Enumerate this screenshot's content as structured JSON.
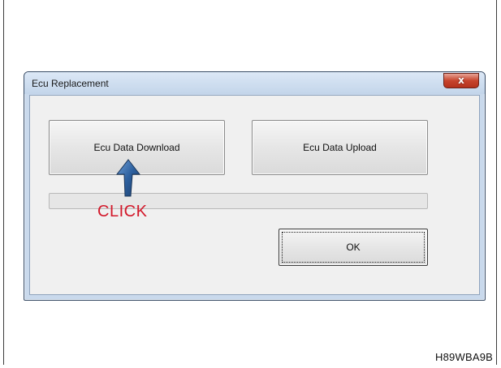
{
  "window": {
    "title": "Ecu Replacement",
    "close_icon": "close-icon",
    "close_glyph": "x"
  },
  "buttons": {
    "download_label": "Ecu Data Download",
    "upload_label": "Ecu Data Upload",
    "ok_label": "OK"
  },
  "progress": {
    "value": 0
  },
  "annotation": {
    "label": "CLICK",
    "label_color": "#d3182a",
    "arrow_icon": "pointer-arrow-icon"
  },
  "figure_code": "H89WBA9B",
  "colors": {
    "title_bar": "#c3d5ea",
    "close_button": "#c7442d",
    "dialog_body": "#f0f0f0"
  }
}
